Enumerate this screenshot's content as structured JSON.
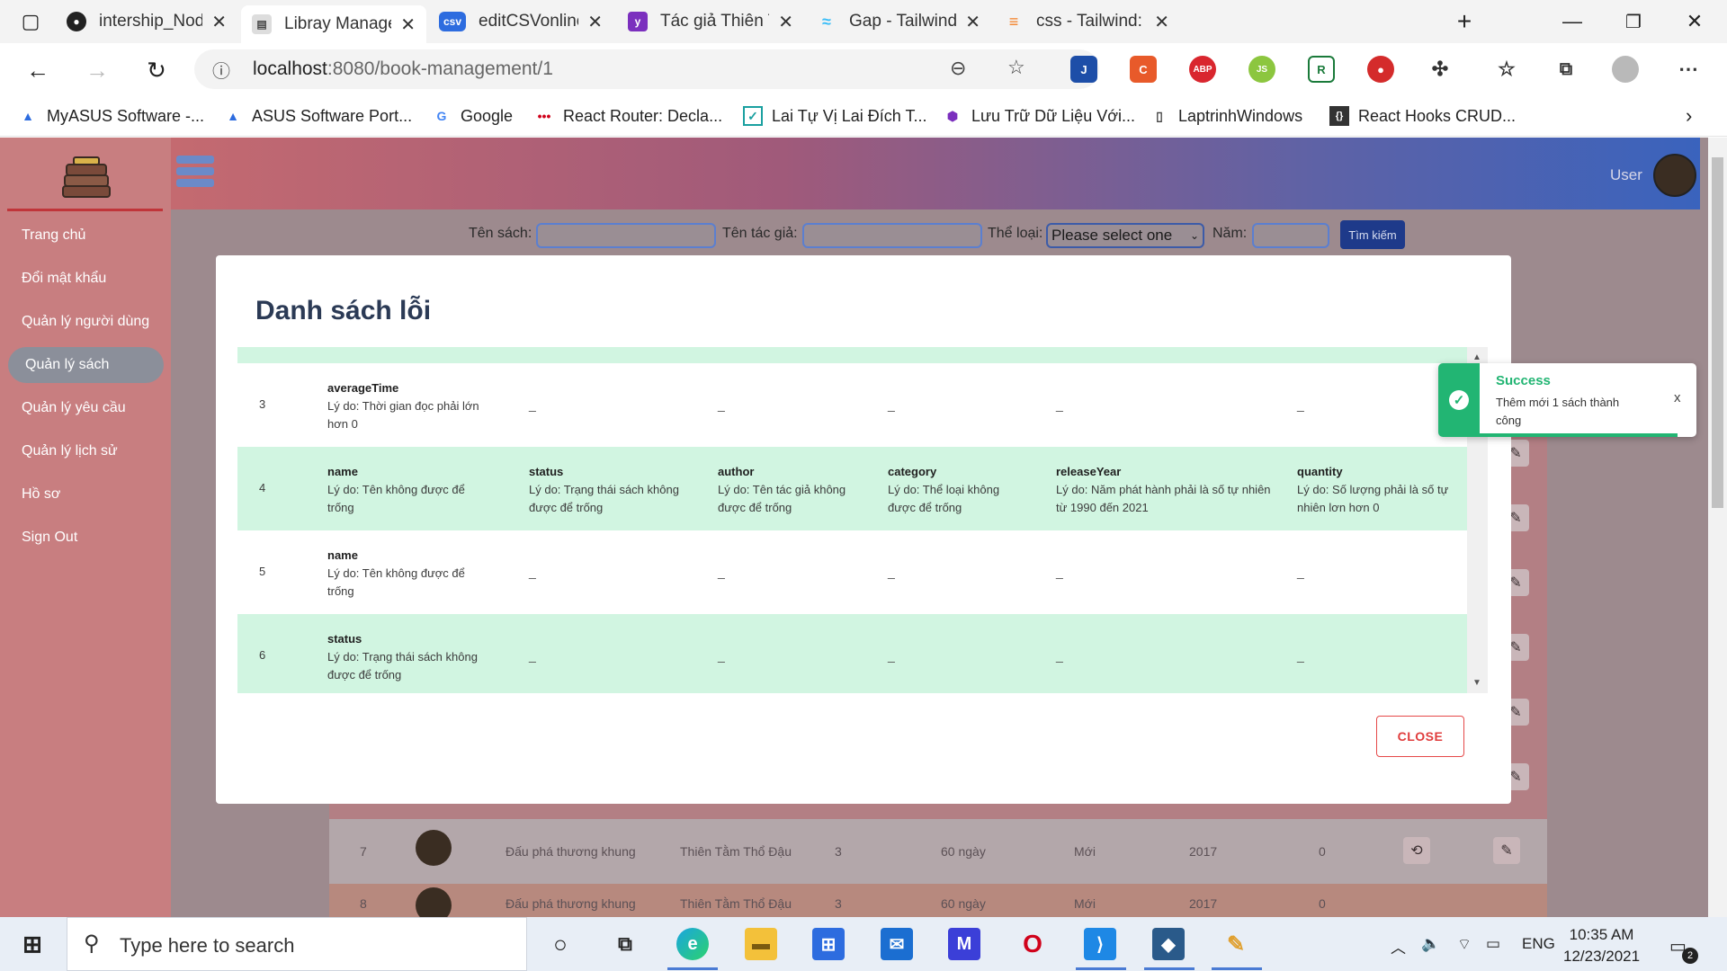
{
  "browser": {
    "tabs": [
      {
        "title": "intership_NodeJS_To",
        "icon": "github-icon"
      },
      {
        "title": "Libray Management",
        "icon": "book-icon"
      },
      {
        "title": "editCSVonline - Edit",
        "icon": "csv-icon"
      },
      {
        "title": "Tác giả Thiên Tâm T",
        "icon": "yahoo-icon"
      },
      {
        "title": "Gap - Tailwind CSS",
        "icon": "tailwind-icon"
      },
      {
        "title": "css - Tailwind: text-c",
        "icon": "stackoverflow-icon"
      }
    ],
    "url_host": "localhost",
    "url_path": ":8080/book-management/1",
    "bookmarks": [
      "MyASUS Software -...",
      "ASUS Software Port...",
      "Google",
      "React Router: Decla...",
      "Lai Tự Vị Lai Đích T...",
      "Lưu Trữ Dữ Liệu Với...",
      "LaptrinhWindows",
      "React Hooks CRUD..."
    ]
  },
  "sidebar": {
    "items": [
      "Trang chủ",
      "Đổi mật khẩu",
      "Quản lý người dùng",
      "Quản lý sách",
      "Quản lý yêu cầu",
      "Quản lý lịch sử",
      "Hồ sơ",
      "Sign Out"
    ],
    "active_index": 3
  },
  "header": {
    "user_label": "User"
  },
  "search": {
    "book_name_label": "Tên sách:",
    "author_label": "Tên tác giả:",
    "category_label": "Thể loại:",
    "category_selected": "Please select one",
    "year_label": "Năm:",
    "search_button": "Tìm kiếm"
  },
  "background_rows": [
    {
      "no": "7",
      "name": "Đấu phá thương khung",
      "author": "Thiên Tằm Thổ Đậu",
      "qty": "3",
      "time": "60 ngày",
      "status": "Mới",
      "year": "2017",
      "count": "0"
    },
    {
      "no": "8",
      "name": "Đấu phá thương khung",
      "author": "Thiên Tằm Thổ Đậu",
      "qty": "3",
      "time": "60 ngày",
      "status": "Mới",
      "year": "2017",
      "count": "0"
    }
  ],
  "background_header_partial": "T",
  "modal": {
    "title": "Danh sách lỗi",
    "close_label": "CLOSE",
    "rows": [
      {
        "index": "3",
        "cells": [
          {
            "field": "averageTime",
            "reason": "Lý do: Thời gian đọc phải lớn hơn 0"
          },
          null,
          null,
          null,
          null,
          null
        ]
      },
      {
        "index": "4",
        "cells": [
          {
            "field": "name",
            "reason": "Lý do: Tên không được để trống"
          },
          {
            "field": "status",
            "reason": "Lý do: Trạng thái sách không được để trống"
          },
          {
            "field": "author",
            "reason": "Lý do: Tên tác giả không được để trống"
          },
          {
            "field": "category",
            "reason": "Lý do: Thể loại không được để trống"
          },
          {
            "field": "releaseYear",
            "reason": "Lý do: Năm phát hành phải là số tự nhiên từ 1990 đến 2021"
          },
          {
            "field": "quantity",
            "reason": "Lý do: Số lượng phải là số tự nhiên lơn hơn 0"
          }
        ]
      },
      {
        "index": "5",
        "cells": [
          {
            "field": "name",
            "reason": "Lý do: Tên không được để trống"
          },
          null,
          null,
          null,
          null,
          null
        ]
      },
      {
        "index": "6",
        "cells": [
          {
            "field": "status",
            "reason": "Lý do: Trạng thái sách không được để trống"
          },
          null,
          null,
          null,
          null,
          null
        ]
      }
    ],
    "empty_placeholder": "_"
  },
  "toast": {
    "title": "Success",
    "message": "Thêm mới 1 sách thành công",
    "close": "x"
  },
  "taskbar": {
    "search_placeholder": "Type here to search",
    "language": "ENG",
    "time": "10:35 AM",
    "date": "12/23/2021",
    "notification_count": "2"
  },
  "colors": {
    "accent_green": "#22b573",
    "row_green": "#d1f5e1",
    "close_red": "#e03c3c",
    "search_button": "#1e3a8a"
  }
}
